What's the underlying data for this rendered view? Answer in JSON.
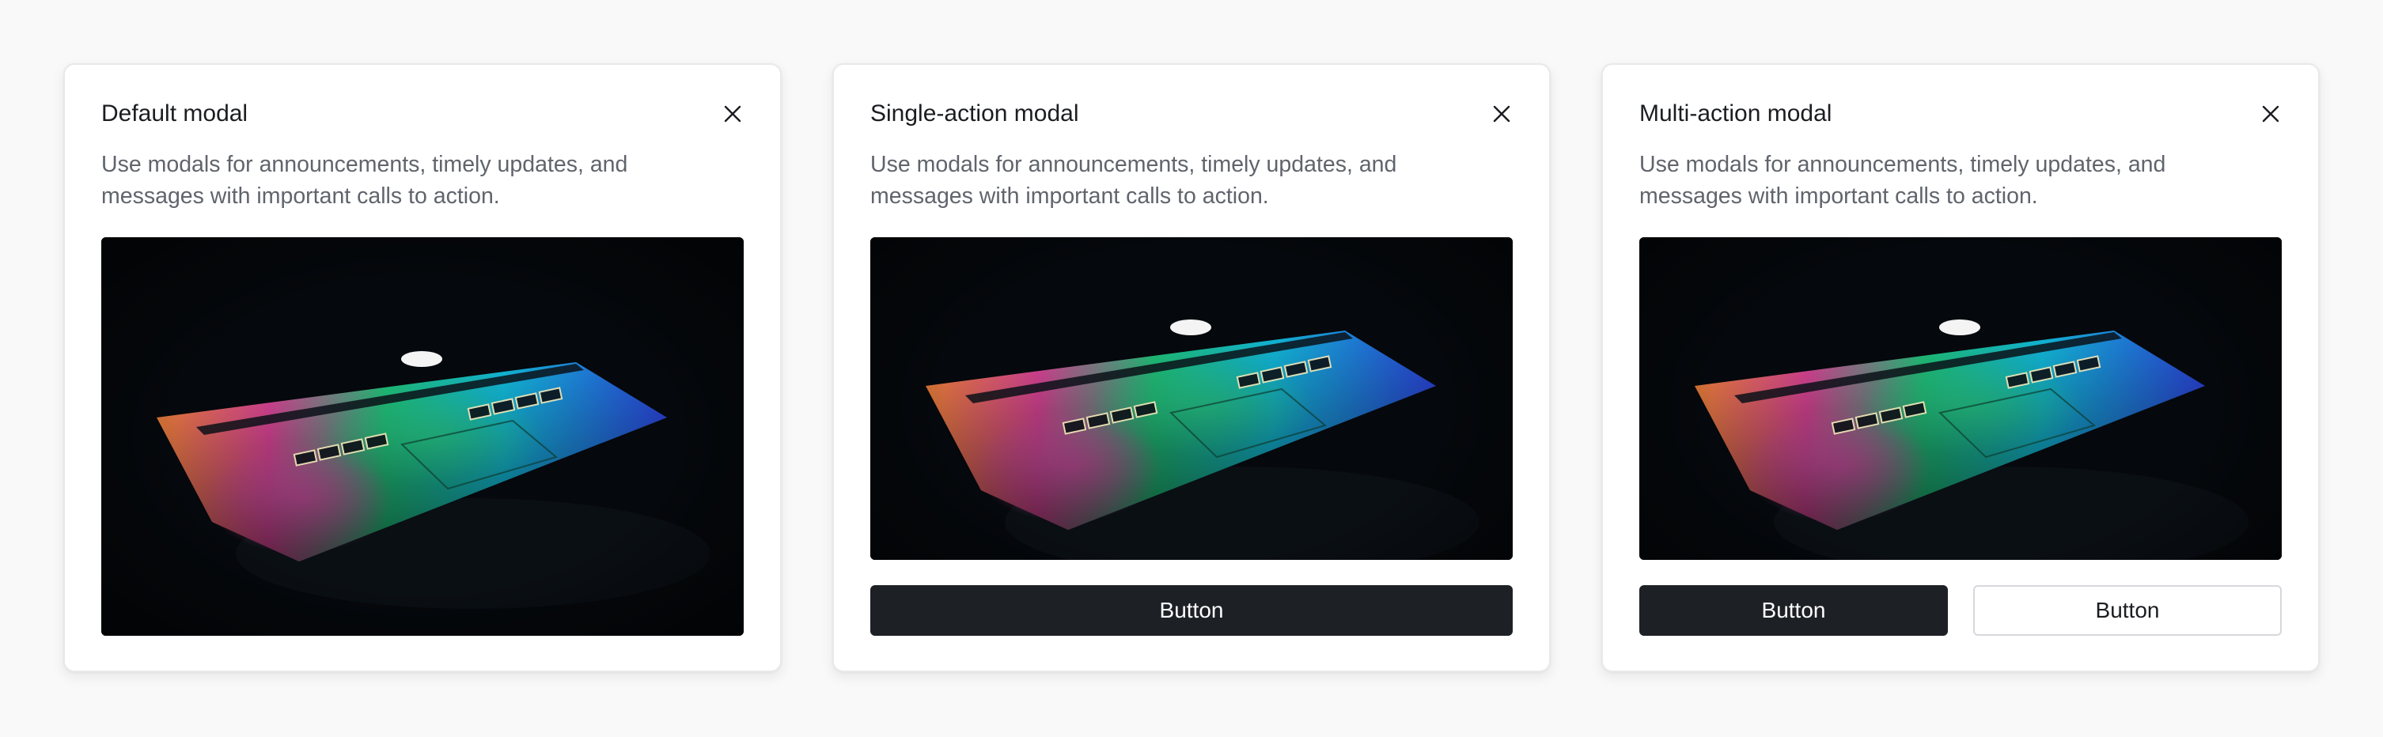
{
  "modals": [
    {
      "title": "Default modal",
      "description": "Use modals for announcements, timely updates, and messages with important calls to action.",
      "close_icon": "close-icon",
      "image": "laptop-rainbow-keyboard-photo",
      "buttons": []
    },
    {
      "title": "Single-action modal",
      "description": "Use modals for announcements, timely updates, and messages with important calls to action.",
      "close_icon": "close-icon",
      "image": "laptop-rainbow-keyboard-photo",
      "buttons": [
        {
          "label": "Button",
          "variant": "primary"
        }
      ]
    },
    {
      "title": "Multi-action modal",
      "description": "Use modals for announcements, timely updates, and messages with important calls to action.",
      "close_icon": "close-icon",
      "image": "laptop-rainbow-keyboard-photo",
      "buttons": [
        {
          "label": "Button",
          "variant": "primary"
        },
        {
          "label": "Button",
          "variant": "secondary"
        }
      ]
    }
  ],
  "colors": {
    "page_background": "#f9f9fa",
    "primary_button": "#1d2025",
    "text_primary": "#1b1d21",
    "text_secondary": "#60646c"
  }
}
